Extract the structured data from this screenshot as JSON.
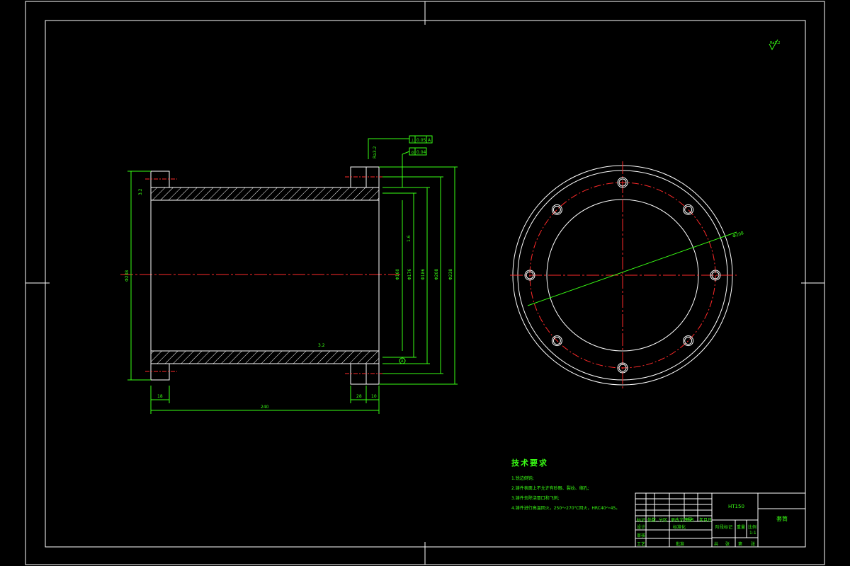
{
  "drawing": {
    "surface_finish_symbol": "Ra3.2",
    "tolerance_frame_1": {
      "symbol": "⊥",
      "value": "0.05",
      "datum": "A"
    },
    "tolerance_frame_2": {
      "symbol": "◎",
      "value": "0.04"
    },
    "dimensions": {
      "overall_length": "240",
      "flange_left": "18",
      "flange_right_a": "28",
      "flange_right_b": "10",
      "dia_outer_left": "Φ238",
      "dia_right_1": "Φ238",
      "dia_right_2": "Φ208",
      "dia_right_3": "Φ186",
      "dia_right_4": "Φ176",
      "dia_inner": "Φ160",
      "pcd": "Φ208",
      "roughness_1": "3.2",
      "roughness_2": "3.2",
      "roughness_3": "1.6",
      "datum_label": "A"
    }
  },
  "tech_notes": {
    "title": "技术要求",
    "items": [
      "1.锐边倒钝;",
      "2.铸件表面上不允许有砂眼、裂纹、缩孔;",
      "3.铸件去除浇冒口和飞刺;",
      "4.铸件进行高温回火，250～270℃回火，HRC40～45。"
    ]
  },
  "title_block": {
    "material": "HT150",
    "part_name": "套筒",
    "labels": [
      "标记",
      "处数",
      "分区",
      "更改文件号",
      "签名",
      "年月日",
      "设计",
      "标准化",
      "阶段标记",
      "重量",
      "比例",
      "审核",
      "工艺",
      "批准",
      "共",
      "张",
      "第",
      "张"
    ],
    "scale": "1:1"
  }
}
